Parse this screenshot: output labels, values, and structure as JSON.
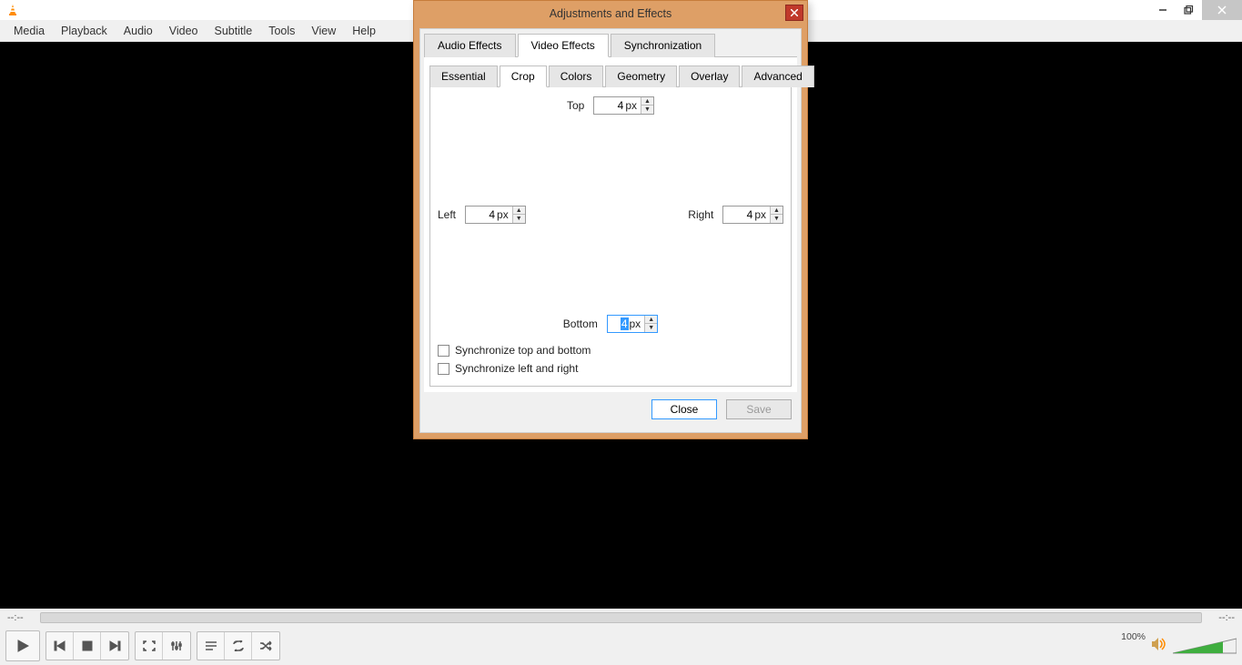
{
  "app": {
    "name": "VLC media player"
  },
  "window_controls": {
    "minimize": "—",
    "maximize": "❐",
    "close": "✕"
  },
  "menu": {
    "media": "Media",
    "playback": "Playback",
    "audio": "Audio",
    "video": "Video",
    "subtitle": "Subtitle",
    "tools": "Tools",
    "view": "View",
    "help": "Help"
  },
  "seek": {
    "elapsed": "--:--",
    "remaining": "--:--"
  },
  "volume": {
    "percent_label": "100%"
  },
  "dialog": {
    "title": "Adjustments and Effects",
    "tabs": {
      "audio_effects": "Audio Effects",
      "video_effects": "Video Effects",
      "synchronization": "Synchronization"
    },
    "video_effects_tabs": {
      "essential": "Essential",
      "crop": "Crop",
      "colors": "Colors",
      "geometry": "Geometry",
      "overlay": "Overlay",
      "advanced": "Advanced"
    },
    "crop": {
      "top_label": "Top",
      "top_value": "4",
      "top_suffix": "px",
      "left_label": "Left",
      "left_value": "4",
      "left_suffix": "px",
      "right_label": "Right",
      "right_value": "4",
      "right_suffix": "px",
      "bottom_label": "Bottom",
      "bottom_value": "4",
      "bottom_suffix": "px",
      "sync_tb_label": "Synchronize top and bottom",
      "sync_lr_label": "Synchronize left and right"
    },
    "buttons": {
      "close": "Close",
      "save": "Save"
    }
  }
}
